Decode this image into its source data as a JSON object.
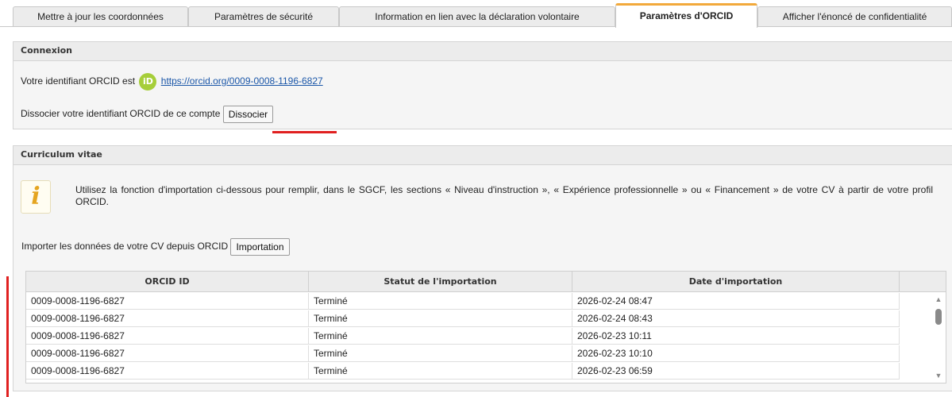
{
  "tabs": [
    {
      "label": "Mettre à jour les coordonnées"
    },
    {
      "label": "Paramètres de sécurité"
    },
    {
      "label": "Information en lien avec la déclaration volontaire"
    },
    {
      "label": "Paramètres d'ORCID"
    },
    {
      "label": "Afficher l'énoncé de confidentialité"
    }
  ],
  "active_tab": "Paramètres d'ORCID",
  "connexion": {
    "header": "Connexion",
    "identifier_text": "Votre identifiant ORCID est",
    "orcid_icon_text": "iD",
    "orcid_link": "https://orcid.org/0009-0008-1196-6827",
    "dissociate_text": "Dissocier votre identifiant ORCID de ce compte",
    "dissociate_button": "Dissocier"
  },
  "cv": {
    "header": "Curriculum vitae",
    "info_icon": "i",
    "info_text": "Utilisez la fonction d'importation ci-dessous pour remplir, dans le SGCF, les sections « Niveau d'instruction », « Expérience professionnelle » ou « Financement » de votre CV à partir de votre profil ORCID.",
    "import_text": "Importer les données de votre CV depuis ORCID",
    "import_button": "Importation"
  },
  "table": {
    "columns": [
      "ORCID ID",
      "Statut de l'importation",
      "Date d'importation"
    ],
    "rows": [
      {
        "orcid": "0009-0008-1196-6827",
        "status": "Terminé",
        "date": "2026-02-24 08:47"
      },
      {
        "orcid": "0009-0008-1196-6827",
        "status": "Terminé",
        "date": "2026-02-24 08:43"
      },
      {
        "orcid": "0009-0008-1196-6827",
        "status": "Terminé",
        "date": "2026-02-23 10:11"
      },
      {
        "orcid": "0009-0008-1196-6827",
        "status": "Terminé",
        "date": "2026-02-23 10:10"
      },
      {
        "orcid": "0009-0008-1196-6827",
        "status": "Terminé",
        "date": "2026-02-23 06:59"
      }
    ]
  },
  "colors": {
    "active_tab_accent": "#f2a93b",
    "orcid_green": "#a6ce39",
    "link": "#1a56a8",
    "highlight_red": "#e02020"
  }
}
